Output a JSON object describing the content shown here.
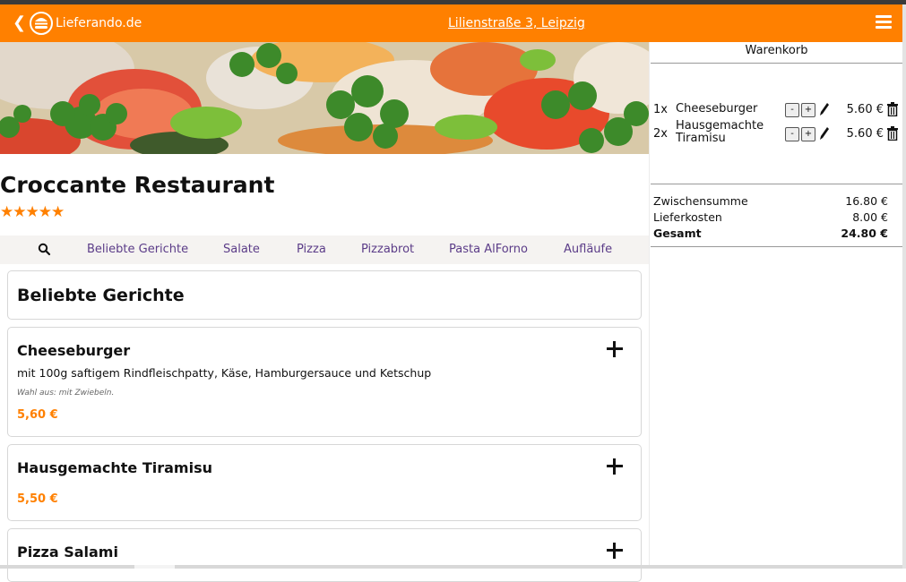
{
  "header": {
    "brand": "Lieferando.de",
    "address": "Lilienstraße 3, Leipzig",
    "accent_color": "#ff8000"
  },
  "restaurant": {
    "name": "Croccante Restaurant",
    "stars": "★★★★★",
    "rating": 5
  },
  "categories": [
    "Beliebte Gerichte",
    "Salate",
    "Pizza",
    "Pizzabrot",
    "Pasta AlForno",
    "Aufläufe"
  ],
  "menu": {
    "section_title": "Beliebte Gerichte",
    "dishes": [
      {
        "name": "Cheeseburger",
        "description": "mit 100g saftigem Rindfleischpatty, Käse, Hamburgersauce und Ketschup",
        "options": "Wahl aus: mit Zwiebeln.",
        "price": "5,60 €"
      },
      {
        "name": "Hausgemachte Tiramisu",
        "price": "5,50 €"
      },
      {
        "name": "Pizza Salami"
      }
    ]
  },
  "cart": {
    "title": "Warenkorb",
    "items": [
      {
        "qty": "1x",
        "name": "Cheeseburger",
        "minus": "-",
        "plus": "+",
        "price": "5.60 €"
      },
      {
        "qty": "2x",
        "name": "Hausgemachte Tiramisu",
        "minus": "-",
        "plus": "+",
        "price": "5.60 €"
      }
    ],
    "subtotal_label": "Zwischensumme",
    "subtotal": "16.80 €",
    "delivery_label": "Lieferkosten",
    "delivery": "8.00 €",
    "total_label": "Gesamt",
    "total": "24.80 €"
  },
  "icons": [
    "back-chevron-icon",
    "burger-logo-icon",
    "hamburger-menu-icon",
    "search-icon",
    "plus-icon",
    "pencil-icon",
    "trash-icon",
    "star-icon"
  ]
}
